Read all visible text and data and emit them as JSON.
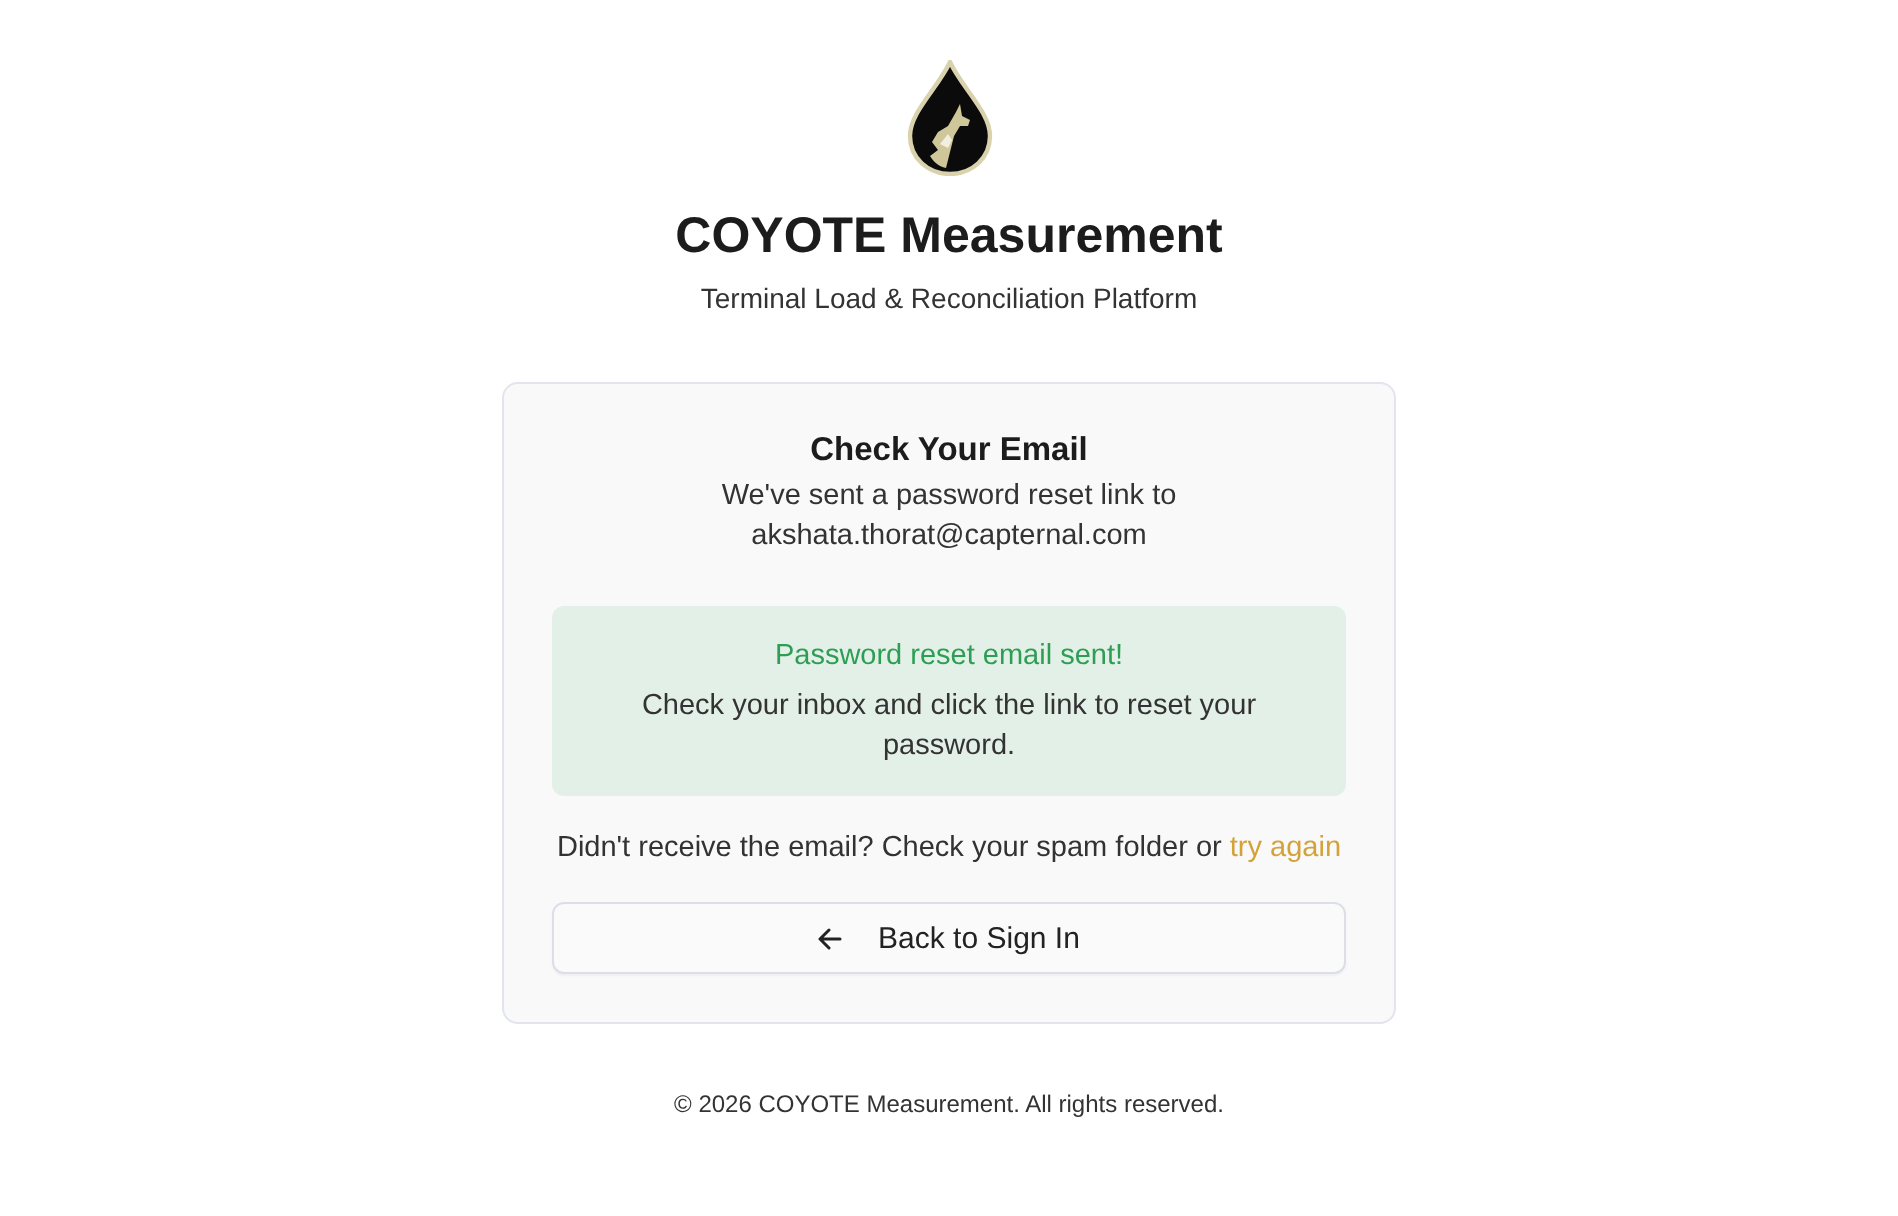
{
  "brand": {
    "title": "COYOTE Measurement",
    "subtitle": "Terminal Load & Reconciliation Platform"
  },
  "card": {
    "heading": "Check Your Email",
    "message": "We've sent a password reset link to",
    "email": "akshata.thorat@capternal.com",
    "alert": {
      "kind": "success",
      "title": "Password reset email sent!",
      "body": "Check your inbox and click the link to reset your password."
    },
    "hint": {
      "text": "Didn't receive the email? Check your spam folder or",
      "link": "try again"
    },
    "back_button": {
      "label": "Back to Sign In"
    }
  },
  "footer": "© 2026 COYOTE Measurement. All rights reserved."
}
